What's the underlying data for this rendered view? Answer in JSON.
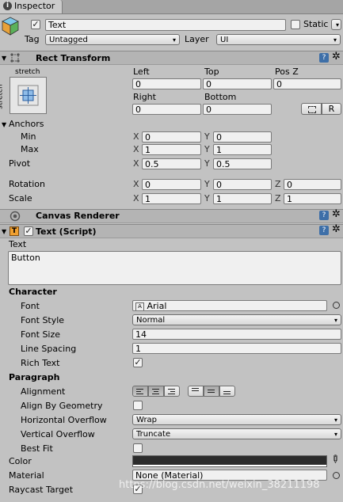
{
  "tab": {
    "title": "Inspector"
  },
  "object": {
    "name": "Text",
    "static_label": "Static",
    "tag_label": "Tag",
    "tag_value": "Untagged",
    "layer_label": "Layer",
    "layer_value": "UI"
  },
  "rect_transform": {
    "title": "Rect Transform",
    "anchor_preset_top": "stretch",
    "anchor_preset_side": "stretch",
    "col1": "Left",
    "col2": "Top",
    "col3": "Pos Z",
    "left": "0",
    "top": "0",
    "posz": "0",
    "col4": "Right",
    "col5": "Bottom",
    "right": "0",
    "bottom": "0",
    "r_button": "R",
    "anchors_label": "Anchors",
    "min_label": "Min",
    "min_x": "0",
    "min_y": "0",
    "max_label": "Max",
    "max_x": "1",
    "max_y": "1",
    "pivot_label": "Pivot",
    "pivot_x": "0.5",
    "pivot_y": "0.5",
    "rotation_label": "Rotation",
    "rot_x": "0",
    "rot_y": "0",
    "rot_z": "0",
    "scale_label": "Scale",
    "scale_x": "1",
    "scale_y": "1",
    "scale_z": "1",
    "x": "X",
    "y": "Y",
    "z": "Z"
  },
  "canvas_renderer": {
    "title": "Canvas Renderer"
  },
  "text_script": {
    "title": "Text (Script)",
    "text_label": "Text",
    "text_value": "Button",
    "character_label": "Character",
    "font_label": "Font",
    "font_value": "Arial",
    "font_style_label": "Font Style",
    "font_style_value": "Normal",
    "font_size_label": "Font Size",
    "font_size_value": "14",
    "line_spacing_label": "Line Spacing",
    "line_spacing_value": "1",
    "rich_text_label": "Rich Text",
    "paragraph_label": "Paragraph",
    "alignment_label": "Alignment",
    "align_by_geometry_label": "Align By Geometry",
    "horizontal_overflow_label": "Horizontal Overflow",
    "horizontal_overflow_value": "Wrap",
    "vertical_overflow_label": "Vertical Overflow",
    "vertical_overflow_value": "Truncate",
    "best_fit_label": "Best Fit",
    "color_label": "Color",
    "color_value": "#2b2b2b",
    "material_label": "Material",
    "material_value": "None (Material)",
    "raycast_label": "Raycast Target"
  },
  "watermark": "https://blog.csdn.net/weixin_38211198"
}
